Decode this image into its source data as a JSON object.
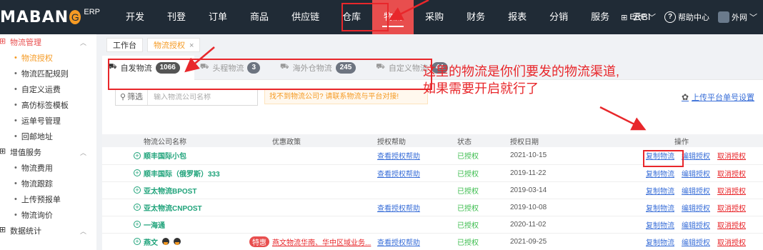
{
  "logo": {
    "text": "MABAN",
    "o": "G",
    "erp": "ERP"
  },
  "nav": [
    "开发",
    "刊登",
    "订单",
    "商品",
    "供应链",
    "仓库",
    "物流",
    "采购",
    "财务",
    "报表",
    "分销",
    "服务",
    "云BI"
  ],
  "nav_active_index": 6,
  "top_right": {
    "erp": "ERP",
    "help": "帮助中心",
    "user": "外网"
  },
  "sidebar": {
    "groups": [
      {
        "label": "物流管理",
        "items": [
          "物流授权",
          "物流匹配规则",
          "自定义运费",
          "高仿标签模板",
          "运单号管理",
          "回邮地址"
        ]
      },
      {
        "label": "增值服务",
        "items": [
          "物流费用",
          "物流跟踪",
          "上传预报单",
          "物流询价"
        ]
      },
      {
        "label": "数据统计",
        "items": []
      }
    ],
    "active_item": "物流授权"
  },
  "page_tabs": {
    "home": "工作台",
    "current": "物流授权",
    "close": "×"
  },
  "sub_tabs": [
    {
      "label": "自发物流",
      "count": "1066"
    },
    {
      "label": "头程物流",
      "count": "3"
    },
    {
      "label": "海外仓物流",
      "count": "245"
    },
    {
      "label": "自定义物流",
      "count": "44"
    }
  ],
  "filter": {
    "prefix": "筛选",
    "placeholder": "输入物流公司名称",
    "tip": "找不到物流公司? 请联系物流与平台对接!",
    "upload_link": "上传平台单号设置"
  },
  "annotation": {
    "line1": "这里的物流是你们要发的物流渠道,",
    "line2": "如果需要开启就行了"
  },
  "table": {
    "headers": [
      "物流公司名称",
      "优惠政策",
      "授权帮助",
      "状态",
      "授权日期",
      "操作"
    ],
    "rows": [
      {
        "name": "顺丰国际小包",
        "policy": "",
        "special": "",
        "help": "查看授权帮助",
        "status": "已授权",
        "date": "2021-10-15"
      },
      {
        "name": "顺丰国际（俄罗斯）333",
        "policy": "",
        "special": "",
        "help": "查看授权帮助",
        "status": "已授权",
        "date": "2019-11-22"
      },
      {
        "name": "亚太物流BPOST",
        "policy": "",
        "special": "",
        "help": "",
        "status": "已授权",
        "date": "2019-03-14"
      },
      {
        "name": "亚太物流CNPOST",
        "policy": "",
        "special": "",
        "help": "查看授权帮助",
        "status": "已授权",
        "date": "2019-10-08"
      },
      {
        "name": "一海通",
        "policy": "",
        "special": "",
        "help": "",
        "status": "已授权",
        "date": "2020-11-02"
      },
      {
        "name": "燕文",
        "policy": "燕文物流华南、华中区域业务...",
        "special": "特惠",
        "help": "查看授权帮助",
        "status": "已授权",
        "date": "2021-09-25"
      }
    ],
    "ops": {
      "copy": "复制物流",
      "edit": "编辑授权",
      "cancel": "取消授权"
    }
  }
}
